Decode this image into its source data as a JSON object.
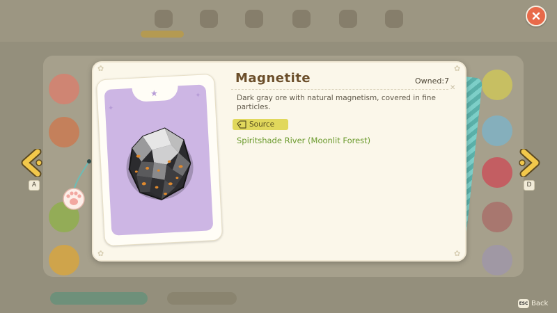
{
  "item": {
    "name": "Magnetite",
    "owned": "Owned:7",
    "description": "Dark gray ore with natural magnetism, covered in fine particles.",
    "source_label": "Source",
    "source_value": "Spiritshade River (Moonlit Forest)"
  },
  "nav": {
    "prev_key": "A",
    "next_key": "D"
  },
  "back": {
    "key": "ESC",
    "label": "Back"
  },
  "colors": {
    "accent_yellow": "#e1d85c",
    "source_text": "#6a9a2c",
    "title": "#6b4e2a",
    "portrait_bg": "#cdb6e4",
    "close": "#e86a4a",
    "arrow": "#f2c84b"
  },
  "icons": {
    "close": "close-icon",
    "prev": "chevron-left-icon",
    "next": "chevron-right-icon",
    "source": "tag-icon",
    "item": "magnetite-ore-icon",
    "charm": "paw-charm-icon"
  }
}
